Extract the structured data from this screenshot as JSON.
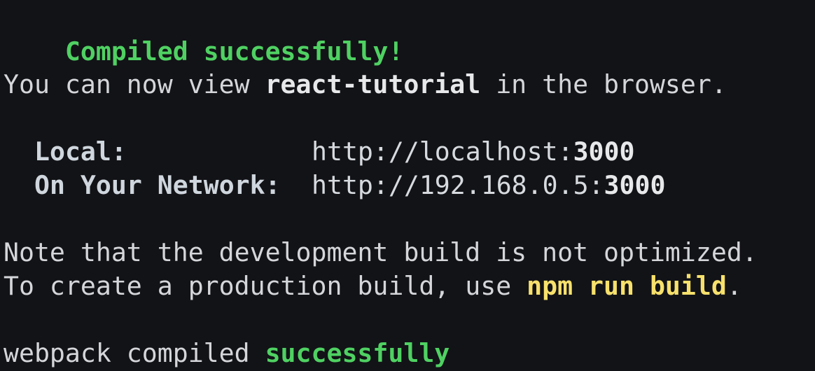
{
  "terminal": {
    "compiled_message": "Compiled successfully!",
    "view_prefix": "You can now view ",
    "app_name": "react-tutorial",
    "view_suffix": " in the browser.",
    "local_label": "Local:",
    "local_url_prefix": "http://localhost:",
    "local_port": "3000",
    "network_label": "On Your Network:",
    "network_url_prefix": "http://192.168.0.5:",
    "network_port": "3000",
    "note_line": "Note that the development build is not optimized.",
    "create_prefix": "To create a production build, use ",
    "build_command": "npm run build",
    "create_suffix": ".",
    "webpack_prefix": "webpack compiled ",
    "webpack_status": "successfully"
  },
  "colors": {
    "background": "#121317",
    "success": "#4fd162",
    "command": "#f7e16c",
    "text": "#d4d6d9"
  }
}
